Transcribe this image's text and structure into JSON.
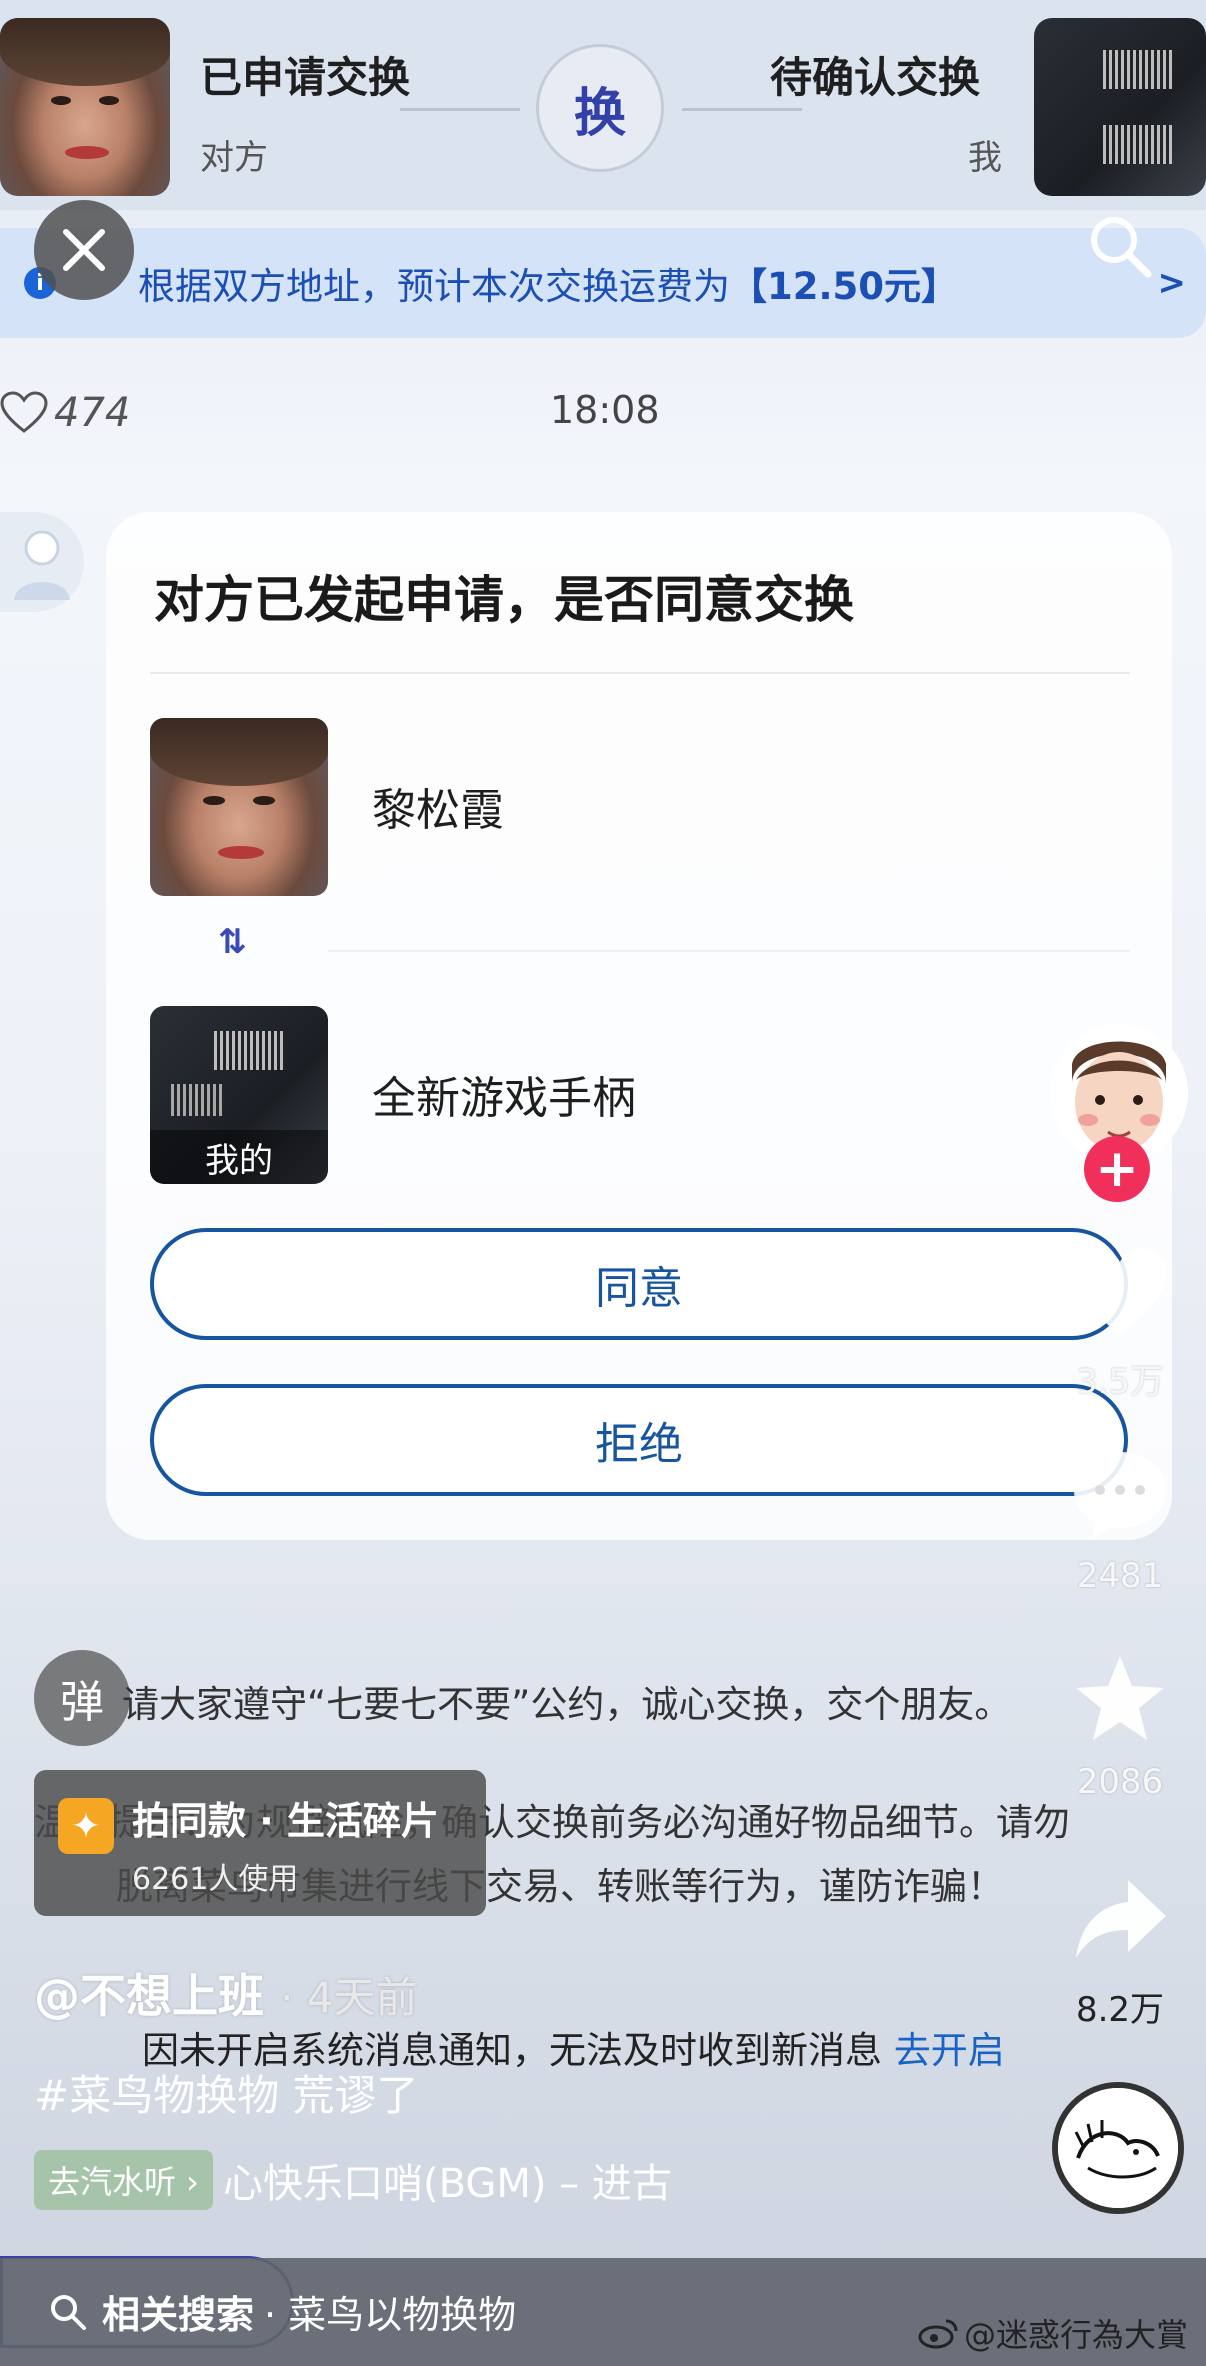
{
  "exchange_header": {
    "left_status": "已申请交换",
    "left_party": "对方",
    "center_icon_text": "换",
    "right_status": "待确认交换",
    "right_party": "我"
  },
  "notice": {
    "text_prefix": "根据双方地址，预计本次交换运费为",
    "fee": "【12.50元】",
    "arrow": ">"
  },
  "likes": "474",
  "time": "18:08",
  "card": {
    "title": "对方已发起申请，是否同意交换",
    "their_item_name": "黎松霞",
    "swap_icon": "⇅",
    "my_item_name": "全新游戏手柄",
    "my_item_tag": "我的",
    "agree_label": "同意",
    "reject_label": "拒绝"
  },
  "right_rail": {
    "follow_symbol": "+",
    "like_count": "3.5万",
    "comment_count": "2481",
    "favorite_count": "2086",
    "share_count": "8.2万"
  },
  "overlay": {
    "danmu_label": "弹",
    "rules_line_1": "请大家遵守“七要七不要”公约，诚心交换，交个朋友。",
    "rules_line_2": "温馨提示：为规避风险，确认交换前务必沟通好物品细节。请勿",
    "rules_line_3": "脱离菜鸟市集进行线下交易、转账等行为，谨防诈骗！",
    "template_title": "拍同款 · 生活碎片",
    "template_users": "6261人使用",
    "author": "@不想上班",
    "posted_ago": "· 4天前",
    "notify_text": "因未开启系统消息通知，无法及时收到新消息",
    "notify_link": "去开启",
    "hashtags": "#菜鸟物换物 荒谬了",
    "music_chip": "去汽水听 ›",
    "music_title": "心快乐口哨(BGM) – 进古"
  },
  "bottom_bar": {
    "search_prefix": "相关搜索",
    "search_query": "· 菜鸟以物换物",
    "watermark": "@迷惑行為大賞"
  },
  "colors": {
    "accent_blue": "#17569e",
    "notice_blue": "#1b4fb4",
    "follow_red": "#f0305a"
  },
  "icons": [
    "close-icon",
    "search-icon",
    "info-icon",
    "heart-icon",
    "user-avatar-icon",
    "swap-icon",
    "comment-icon",
    "star-icon",
    "share-icon",
    "weibo-icon"
  ]
}
